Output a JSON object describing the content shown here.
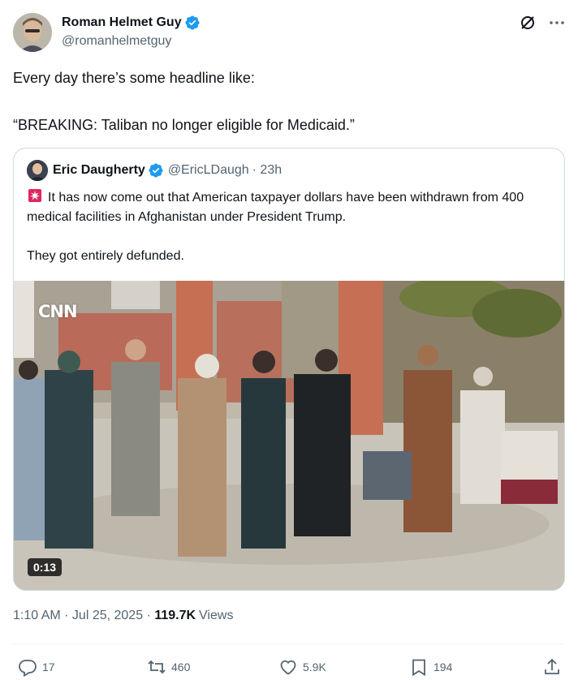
{
  "post": {
    "author_name": "Roman Helmet Guy",
    "author_handle": "@romanhelmetguy",
    "text_line1": "Every day there’s some headline like:",
    "text_line2": "“BREAKING: Taliban no longer eligible for Medicaid.”"
  },
  "quote": {
    "author_name": "Eric Daugherty",
    "author_handle": "@EricLDaugh",
    "time_ago": "· 23h",
    "text_para1": "It has now come out that American taxpayer dollars have been withdrawn from 400 medical facilities in Afghanistan under President Trump.",
    "text_para2": "They got entirely defunded.",
    "media": {
      "watermark": "CNN",
      "duration": "0:13"
    }
  },
  "meta": {
    "timestamp": "1:10 AM · Jul 25, 2025 · ",
    "views_count": "119.7K",
    "views_label": "Views"
  },
  "actions": {
    "replies": "17",
    "reposts": "460",
    "likes": "5.9K",
    "bookmarks": "194"
  },
  "colors": {
    "verified": "#1d9bf0",
    "secondary_text": "#536471",
    "border": "#cfd9de"
  },
  "icons": [
    "verified-badge-icon",
    "grok-icon",
    "more-icon",
    "siren-icon",
    "reply-icon",
    "repost-icon",
    "like-icon",
    "bookmark-icon",
    "share-icon"
  ]
}
